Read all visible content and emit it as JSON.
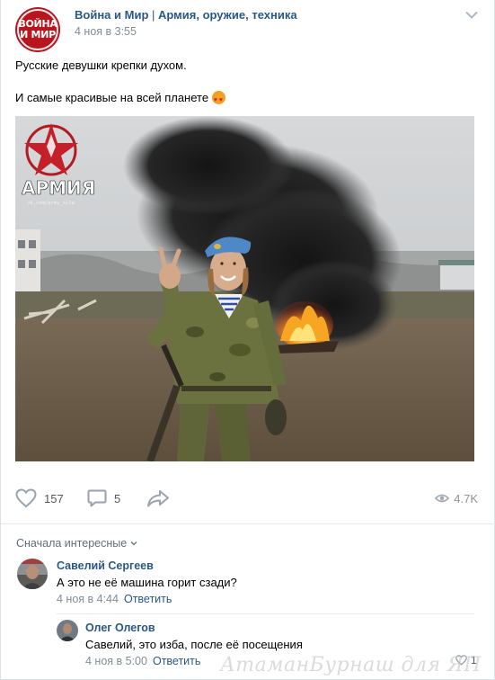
{
  "post": {
    "group_avatar_text": [
      "ВОЙНА",
      "И МИР"
    ],
    "author": "Война и Мир | Армия, оружие, техника",
    "date": "4 ноя в 3:55",
    "text_lines": [
      "Русские девушки крепки духом.",
      "И самые красивые на всей планете"
    ],
    "emoji": "heart-eyes-emoji",
    "photo_logo_text": "АРМИЯ",
    "photo_logo_url": "vk.com/army_sila"
  },
  "actions": {
    "likes": "157",
    "comments": "5",
    "views": "4.7K"
  },
  "comments_header": {
    "sort_label": "Сначала интересные"
  },
  "comments": [
    {
      "author": "Савелий Сергеев",
      "text": "А это не её машина горит сзади?",
      "date": "4 ноя в 4:44",
      "reply_label": "Ответить"
    },
    {
      "author": "Олег Олегов",
      "text": "Савелий, это изба, после её посещения",
      "date": "4 ноя в 5:00",
      "reply_label": "Ответить",
      "likes": "1"
    }
  ],
  "watermark": "АтаманБурнаш для ЯП",
  "colors": {
    "link": "#2a5885",
    "meta": "#818c99",
    "brand_red": "#b8161f"
  }
}
